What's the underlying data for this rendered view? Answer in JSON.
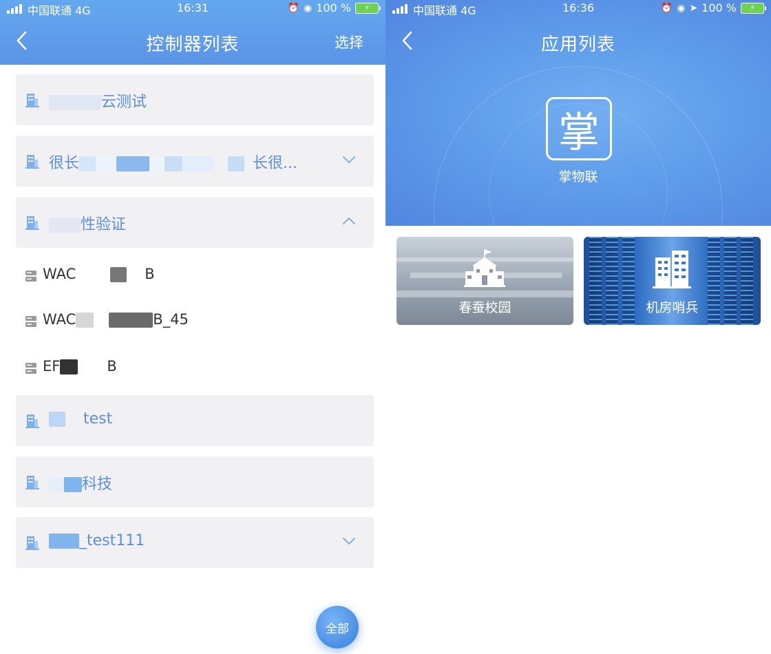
{
  "left": {
    "status": {
      "carrier": "中国联通 4G",
      "time": "16:31",
      "battery": "100 %"
    },
    "nav": {
      "title": "控制器列表",
      "action": "选择"
    },
    "groups": [
      {
        "label": "云测试"
      },
      {
        "label": "很长",
        "suffix": "长很..."
      },
      {
        "label": "性验证"
      },
      {
        "label": "test"
      },
      {
        "label": "科技"
      },
      {
        "label": "_test111"
      }
    ],
    "devices": [
      {
        "prefix": "WAC",
        "suffix": "B"
      },
      {
        "prefix": "WAC",
        "suffix": "B_45"
      },
      {
        "prefix": "EF",
        "suffix": "B"
      }
    ],
    "fab": "全部"
  },
  "right": {
    "status": {
      "carrier": "中国联通 4G",
      "time": "16:36",
      "battery": "100 %"
    },
    "nav": {
      "title": "应用列表"
    },
    "app": {
      "glyph": "掌",
      "name": "掌物联"
    },
    "tiles": [
      {
        "label": "春蚕校园"
      },
      {
        "label": "机房哨兵"
      }
    ]
  },
  "colors": {
    "header": "#5b94e6",
    "accent_text": "#5b8fe0",
    "card_bg": "#f1f1f3"
  },
  "icons": [
    "signal-icon",
    "back-arrow-icon",
    "building-icon",
    "chevron-down-icon",
    "chevron-up-icon",
    "server-icon",
    "alarm-icon",
    "lock-rotation-icon",
    "location-icon",
    "battery-icon",
    "school-icon",
    "server-building-icon"
  ]
}
